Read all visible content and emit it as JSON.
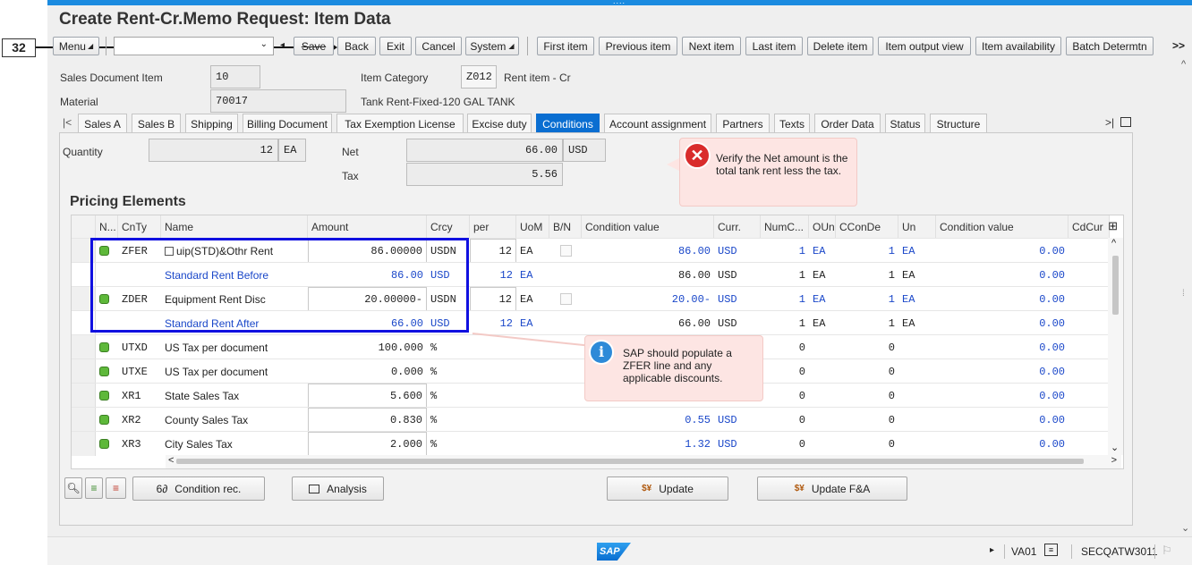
{
  "header": {
    "title": "Create Rent-Cr.Memo Request: Item Data",
    "step_badge": "32"
  },
  "toolbar": {
    "menu": "Menu",
    "save": "Save",
    "back": "Back",
    "exit": "Exit",
    "cancel": "Cancel",
    "system": "System",
    "first_item": "First item",
    "previous_item": "Previous item",
    "next_item": "Next item",
    "last_item": "Last item",
    "delete_item": "Delete item",
    "item_output_view": "Item output view",
    "item_availability": "Item availability",
    "batch_determtn": "Batch Determtn",
    "overflow": ">>"
  },
  "item": {
    "sales_doc_item_label": "Sales Document Item",
    "sales_doc_item_value": "10",
    "item_category_label": "Item Category",
    "item_category_value": "Z012",
    "item_category_desc": "Rent item - Cr",
    "material_label": "Material",
    "material_value": "70017",
    "material_desc": "Tank Rent-Fixed-120 GAL TANK"
  },
  "tabs": [
    "Sales A",
    "Sales B",
    "Shipping",
    "Billing Document",
    "Tax Exemption License",
    "Excise duty",
    "Conditions",
    "Account assignment",
    "Partners",
    "Texts",
    "Order Data",
    "Status",
    "Structure"
  ],
  "active_tab": "Conditions",
  "conditions": {
    "quantity_label": "Quantity",
    "quantity_value": "12",
    "quantity_unit": "EA",
    "net_label": "Net",
    "net_value": "66.00",
    "net_currency": "USD",
    "tax_label": "Tax",
    "tax_value": "5.56"
  },
  "pricing": {
    "title": "Pricing Elements",
    "columns": [
      "N...",
      "CnTy",
      "Name",
      "Amount",
      "Crcy",
      "per",
      "UoM",
      "B/N",
      "Condition value",
      "Curr.",
      "NumC...",
      "OUn",
      "CConDe",
      "Un",
      "Condition value",
      "CdCur"
    ],
    "rows": [
      {
        "status": "green",
        "cnty": "ZFER",
        "name": "uip(STD)&Othr Rent",
        "amount": "86.00000",
        "crcy": "USDN",
        "per": "12",
        "uom": "EA",
        "bn": true,
        "cond_value": "86.00",
        "curr": "USD",
        "numc": "1",
        "oun": "EA",
        "cconde": "1",
        "un": "EA",
        "cond_value2": "0.00",
        "blue": false,
        "editable": true,
        "copy_icon": true
      },
      {
        "status": "",
        "cnty": "",
        "name": "Standard Rent Before",
        "amount": "86.00",
        "crcy": "USD",
        "per": "12",
        "uom": "EA",
        "bn": false,
        "cond_value": "86.00",
        "curr": "USD",
        "numc": "1",
        "oun": "EA",
        "cconde": "1",
        "un": "EA",
        "cond_value2": "0.00",
        "blue": true,
        "editable": false
      },
      {
        "status": "green",
        "cnty": "ZDER",
        "name": "Equipment Rent Disc",
        "amount": "20.00000-",
        "crcy": "USDN",
        "per": "12",
        "uom": "EA",
        "bn": true,
        "cond_value": "20.00-",
        "curr": "USD",
        "numc": "1",
        "oun": "EA",
        "cconde": "1",
        "un": "EA",
        "cond_value2": "0.00",
        "blue": false,
        "editable": true
      },
      {
        "status": "",
        "cnty": "",
        "name": "Standard Rent After",
        "amount": "66.00",
        "crcy": "USD",
        "per": "12",
        "uom": "EA",
        "bn": false,
        "cond_value": "66.00",
        "curr": "USD",
        "numc": "1",
        "oun": "EA",
        "cconde": "1",
        "un": "EA",
        "cond_value2": "0.00",
        "blue": true,
        "editable": false
      },
      {
        "status": "green",
        "cnty": "UTXD",
        "name": "US Tax per document",
        "amount": "100.000",
        "crcy": "%",
        "per": "",
        "uom": "",
        "bn": false,
        "cond_value": "",
        "curr": "",
        "numc": "0",
        "oun": "",
        "cconde": "0",
        "un": "",
        "cond_value2": "0.00",
        "blue": false,
        "editable": false
      },
      {
        "status": "green",
        "cnty": "UTXE",
        "name": "US Tax per document",
        "amount": "0.000",
        "crcy": "%",
        "per": "",
        "uom": "",
        "bn": false,
        "cond_value": "",
        "curr": "",
        "numc": "0",
        "oun": "",
        "cconde": "0",
        "un": "",
        "cond_value2": "0.00",
        "blue": false,
        "editable": false
      },
      {
        "status": "green",
        "cnty": "XR1",
        "name": "State Sales Tax",
        "amount": "5.600",
        "crcy": "%",
        "per": "",
        "uom": "",
        "bn": false,
        "cond_value": "",
        "curr": "",
        "numc": "0",
        "oun": "",
        "cconde": "0",
        "un": "",
        "cond_value2": "0.00",
        "blue": false,
        "editable": true
      },
      {
        "status": "green",
        "cnty": "XR2",
        "name": "County Sales Tax",
        "amount": "0.830",
        "crcy": "%",
        "per": "",
        "uom": "",
        "bn": false,
        "cond_value": "0.55",
        "curr": "USD",
        "numc": "0",
        "oun": "",
        "cconde": "0",
        "un": "",
        "cond_value2": "0.00",
        "blue": false,
        "editable": true
      },
      {
        "status": "green",
        "cnty": "XR3",
        "name": "City Sales Tax",
        "amount": "2.000",
        "crcy": "%",
        "per": "",
        "uom": "",
        "bn": false,
        "cond_value": "1.32",
        "curr": "USD",
        "numc": "0",
        "oun": "",
        "cconde": "0",
        "un": "",
        "cond_value2": "0.00",
        "blue": false,
        "editable": true
      }
    ]
  },
  "callouts": {
    "error": "Verify the Net amount is the total tank rent less the tax.",
    "info": "SAP should populate a ZFER line and any applicable discounts."
  },
  "buttons": {
    "condition_rec": "Condition rec.",
    "analysis": "Analysis",
    "update": "Update",
    "update_fa": "Update F&A"
  },
  "status": {
    "brand": "SAP",
    "transaction": "VA01",
    "system": "SECQATW3011"
  },
  "colors": {
    "accent": "#0a6ed1",
    "highlight_box": "#1010e0",
    "status_green": "#5eb83a"
  }
}
